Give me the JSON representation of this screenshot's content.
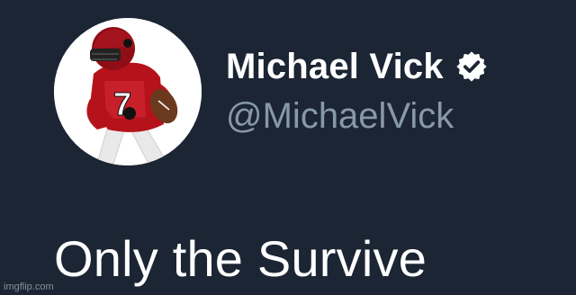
{
  "tweet": {
    "avatar_icon": "player-avatar-icon",
    "display_name": "Michael Vick",
    "verified_icon": "verified-badge-icon",
    "handle": "@MichaelVick",
    "text": "Only the Survive"
  },
  "watermark": "imgflip.com",
  "colors": {
    "background": "#1b2533",
    "name": "#ffffff",
    "handle": "#8899a6",
    "text": "#ffffff"
  }
}
